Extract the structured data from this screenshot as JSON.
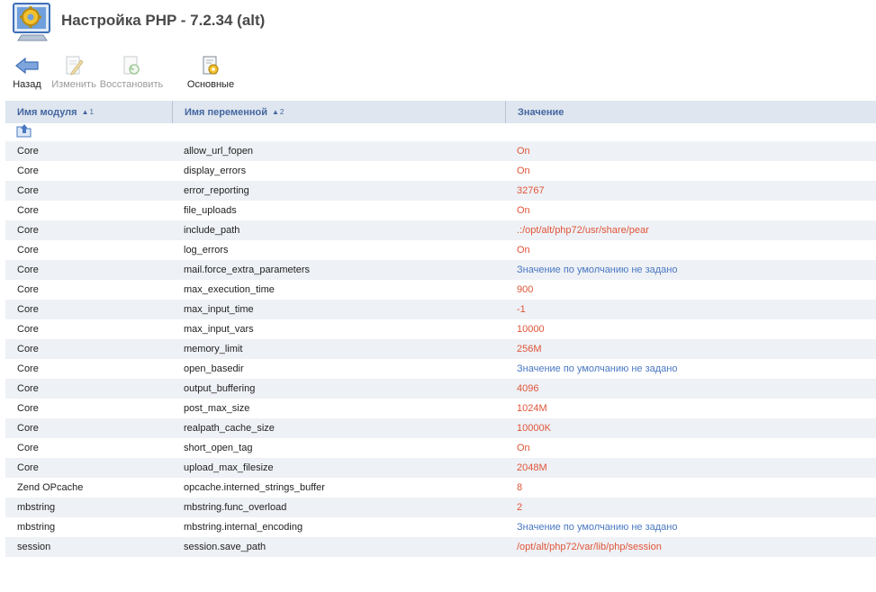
{
  "header": {
    "title": "Настройка PHP - 7.2.34 (alt)"
  },
  "toolbar": {
    "back": "Назад",
    "edit": "Изменить",
    "restore": "Восстановить",
    "basic": "Основные"
  },
  "grid": {
    "columns": {
      "module": "Имя модуля",
      "module_sort": "1",
      "variable": "Имя переменной",
      "variable_sort": "2",
      "value": "Значение"
    },
    "rows": [
      {
        "module": "Core",
        "variable": "allow_url_fopen",
        "value": "On",
        "is_default": false
      },
      {
        "module": "Core",
        "variable": "display_errors",
        "value": "On",
        "is_default": false
      },
      {
        "module": "Core",
        "variable": "error_reporting",
        "value": "32767",
        "is_default": false
      },
      {
        "module": "Core",
        "variable": "file_uploads",
        "value": "On",
        "is_default": false
      },
      {
        "module": "Core",
        "variable": "include_path",
        "value": ".:/opt/alt/php72/usr/share/pear",
        "is_default": false
      },
      {
        "module": "Core",
        "variable": "log_errors",
        "value": "On",
        "is_default": false
      },
      {
        "module": "Core",
        "variable": "mail.force_extra_parameters",
        "value": "Значение по умолчанию не задано",
        "is_default": true
      },
      {
        "module": "Core",
        "variable": "max_execution_time",
        "value": "900",
        "is_default": false
      },
      {
        "module": "Core",
        "variable": "max_input_time",
        "value": "-1",
        "is_default": false
      },
      {
        "module": "Core",
        "variable": "max_input_vars",
        "value": "10000",
        "is_default": false
      },
      {
        "module": "Core",
        "variable": "memory_limit",
        "value": "256M",
        "is_default": false
      },
      {
        "module": "Core",
        "variable": "open_basedir",
        "value": "Значение по умолчанию не задано",
        "is_default": true
      },
      {
        "module": "Core",
        "variable": "output_buffering",
        "value": "4096",
        "is_default": false
      },
      {
        "module": "Core",
        "variable": "post_max_size",
        "value": "1024M",
        "is_default": false
      },
      {
        "module": "Core",
        "variable": "realpath_cache_size",
        "value": "10000K",
        "is_default": false
      },
      {
        "module": "Core",
        "variable": "short_open_tag",
        "value": "On",
        "is_default": false
      },
      {
        "module": "Core",
        "variable": "upload_max_filesize",
        "value": "2048M",
        "is_default": false
      },
      {
        "module": "Zend OPcache",
        "variable": "opcache.interned_strings_buffer",
        "value": "8",
        "is_default": false
      },
      {
        "module": "mbstring",
        "variable": "mbstring.func_overload",
        "value": "2",
        "is_default": false
      },
      {
        "module": "mbstring",
        "variable": "mbstring.internal_encoding",
        "value": "Значение по умолчанию не задано",
        "is_default": true
      },
      {
        "module": "session",
        "variable": "session.save_path",
        "value": "/opt/alt/php72/var/lib/php/session",
        "is_default": false
      }
    ]
  },
  "colors": {
    "value_set": "#e0553a",
    "value_default": "#4a78c2",
    "header_bg": "#dfe6ef",
    "header_text": "#4466a0",
    "row_alt": "#eef1f5"
  },
  "icons": {
    "app": "gear-monitor-icon",
    "back": "back-arrow-icon",
    "edit": "edit-document-icon",
    "restore": "restore-icon",
    "basic": "settings-document-icon",
    "up": "up-folder-icon"
  }
}
